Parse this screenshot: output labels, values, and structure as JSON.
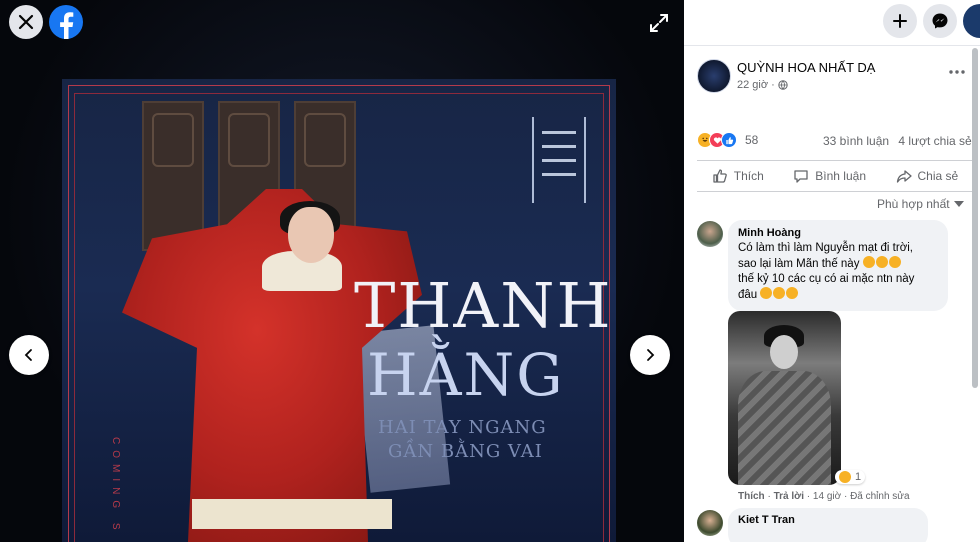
{
  "viewer": {
    "close_label": "✕",
    "fb_letter": "f",
    "photo": {
      "title_line1": "THANH",
      "title_line2": "HẰNG",
      "subtitle_line1": "HAI TAY NGANG",
      "subtitle_line2": "GẦN BẰNG VAI",
      "side_text": "COMING S"
    }
  },
  "post": {
    "page_name": "QUỲNH HOA NHẤT DẠ",
    "time": "22 giờ",
    "reaction_count": "58",
    "comments_count": "33 bình luận",
    "shares_count": "4 lượt chia sẻ",
    "actions": {
      "like": "Thích",
      "comment": "Bình luận",
      "share": "Chia sẻ"
    },
    "filter_label": "Phù hợp nhất"
  },
  "comments": [
    {
      "author": "Minh Hoàng",
      "line1": "Có làm thì làm Nguyễn mạt đi trời,",
      "line2": "sao lại làm Mãn thế này",
      "line3": "thế kỷ 10 các cụ có ai mặc ntn này",
      "line4": "đâu",
      "photo_reaction_count": "1",
      "meta_like": "Thích",
      "meta_reply": "Trả lời",
      "meta_time": "14 giờ",
      "meta_edited": "Đã chỉnh sửa"
    },
    {
      "author": "Kiet T Tran"
    }
  ],
  "colors": {
    "facebook_blue": "#1877f2",
    "comment_bg": "#f0f2f5",
    "muted_text": "#65676b"
  }
}
